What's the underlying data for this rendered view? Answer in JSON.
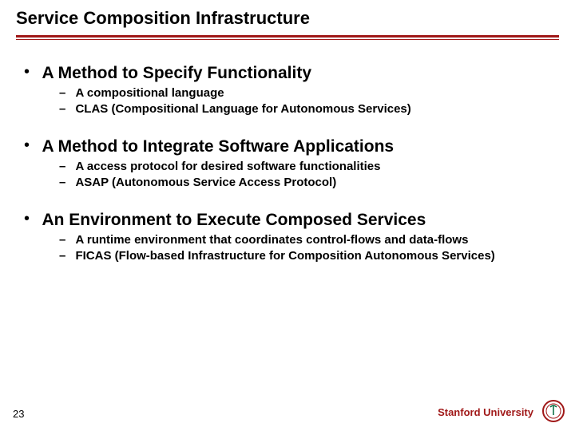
{
  "title": "Service Composition Infrastructure",
  "sections": [
    {
      "heading": "A Method to Specify Functionality",
      "subs": [
        "A compositional language",
        "CLAS (Compositional Language for Autonomous Services)"
      ]
    },
    {
      "heading": "A Method to Integrate Software Applications",
      "subs": [
        "A access protocol for desired software functionalities",
        "ASAP (Autonomous Service Access Protocol)"
      ]
    },
    {
      "heading": "An Environment to Execute Composed Services",
      "subs": [
        "A runtime environment that coordinates control-flows and data-flows",
        "FICAS (Flow-based Infrastructure for Composition Autonomous Services)"
      ]
    }
  ],
  "footer": {
    "page": "23",
    "org": "Stanford University"
  },
  "colors": {
    "accent": "#a01818"
  }
}
